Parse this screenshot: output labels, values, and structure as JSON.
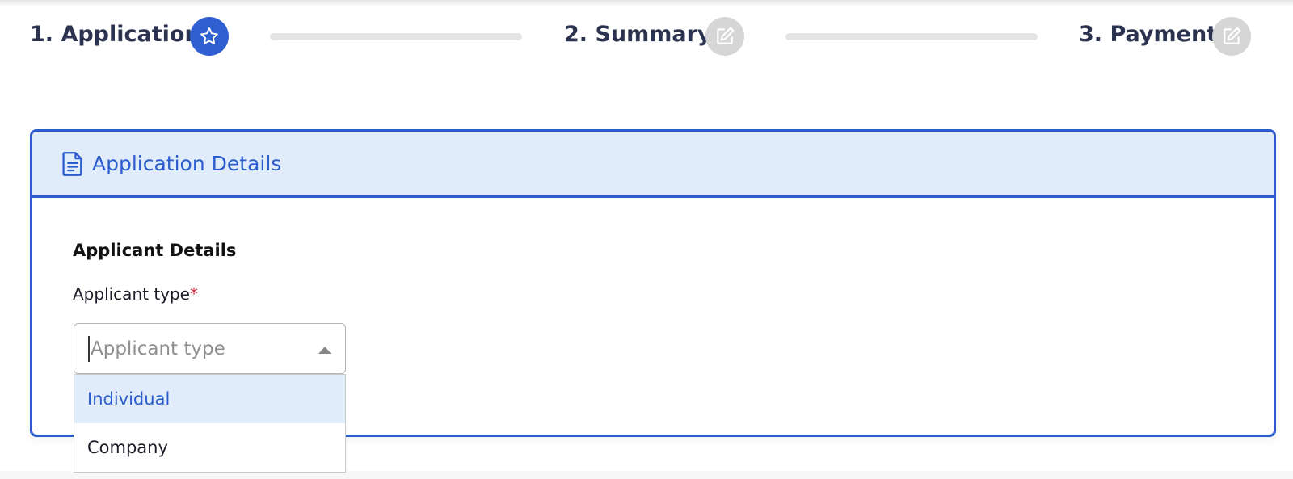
{
  "stepper": {
    "steps": [
      {
        "label": "1. Application",
        "state": "active",
        "icon": "star-icon"
      },
      {
        "label": "2. Summary",
        "state": "inactive",
        "icon": "edit-icon"
      },
      {
        "label": "3. Payment",
        "state": "inactive",
        "icon": "edit-icon"
      }
    ]
  },
  "card": {
    "title": "Application Details",
    "icon": "document-icon"
  },
  "form": {
    "section_title": "Applicant Details",
    "applicant_type_label": "Applicant type",
    "required_mark": "*",
    "applicant_type_placeholder": "Applicant type",
    "applicant_type_value": "",
    "options": [
      "Individual",
      "Company"
    ],
    "highlighted_option": "Individual"
  },
  "colors": {
    "accent": "#2b5ccd",
    "header_bg": "#e1ecfa",
    "inactive_step": "#d6d6d6",
    "required": "#d0283c"
  }
}
